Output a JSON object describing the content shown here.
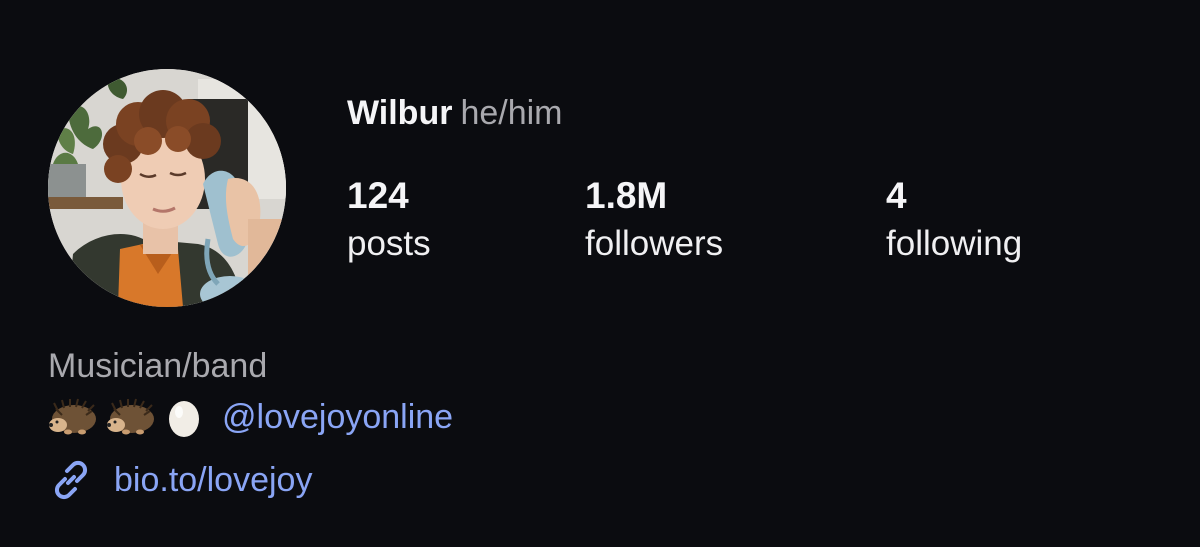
{
  "profile": {
    "display_name": "Wilbur",
    "pronouns": "he/him",
    "avatar_icon": "profile-photo"
  },
  "stats": {
    "posts": {
      "count": "124",
      "label": "posts"
    },
    "followers": {
      "count": "1.8M",
      "label": "followers"
    },
    "following": {
      "count": "4",
      "label": "following"
    }
  },
  "bio": {
    "category": "Musician/band",
    "emojis": [
      "hedgehog",
      "hedgehog",
      "egg"
    ],
    "mention": "@lovejoyonline",
    "link_icon": "link-icon",
    "link_text": "bio.to/lovejoy"
  },
  "colors": {
    "background": "#0b0c10",
    "primary_text": "#f5f5f7",
    "secondary_text": "#a9a9ae",
    "link": "#8aa5f5"
  }
}
